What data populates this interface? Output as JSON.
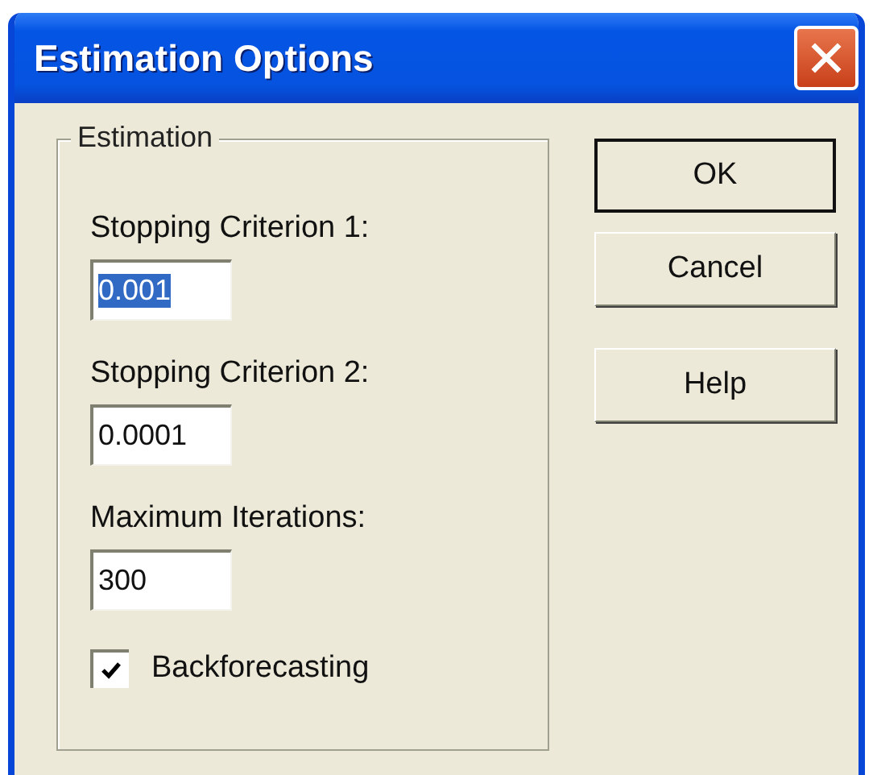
{
  "window": {
    "title": "Estimation Options"
  },
  "group": {
    "title": "Estimation",
    "fields": [
      {
        "label": "Stopping Criterion 1:",
        "value": "0.001",
        "highlighted": true
      },
      {
        "label": "Stopping Criterion 2:",
        "value": "0.0001",
        "highlighted": false
      },
      {
        "label": "Maximum Iterations:",
        "value": "300",
        "highlighted": false
      }
    ],
    "checkbox": {
      "label": "Backforecasting",
      "checked": true
    }
  },
  "buttons": [
    {
      "label": "OK",
      "default": true
    },
    {
      "label": "Cancel",
      "default": false
    },
    {
      "label": "Help",
      "default": false
    }
  ]
}
